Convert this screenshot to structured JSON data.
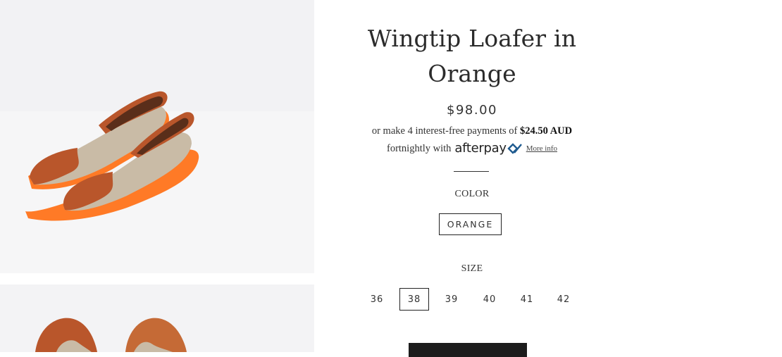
{
  "product": {
    "title_line1": "Wingtip Loafer in",
    "title_line2": "Orange",
    "price": "$98.00",
    "installment_text": "or make 4 interest-free payments of ",
    "installment_amount": "$24.50 AUD",
    "installment_text2": "fortnightly with",
    "afterpay_brand": "afterpay",
    "more_info": "More info"
  },
  "options": {
    "color_label": "COLOR",
    "color_value": "ORANGE",
    "size_label": "SIZE",
    "sizes": [
      "36",
      "38",
      "39",
      "40",
      "41",
      "42"
    ],
    "selected_size": "38"
  },
  "images": {
    "photo1_icon": "shoe-pair-side-photo",
    "photo2_icon": "shoe-pair-top-photo"
  },
  "colors": {
    "suede": "#b9562b",
    "canvas": "#c9bba6",
    "sole": "#ff7a26",
    "button_dark": "#1c1c1c"
  }
}
